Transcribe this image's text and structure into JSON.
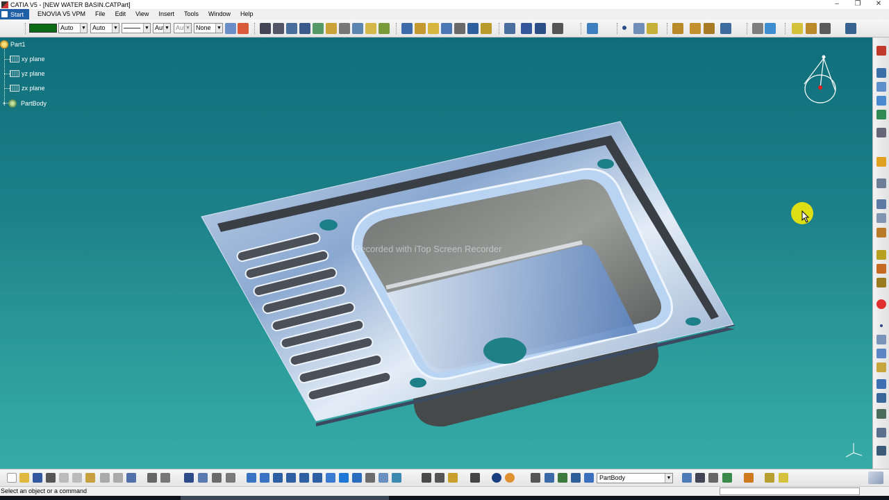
{
  "window": {
    "title": "CATIA V5 - [NEW WATER BASIN.CATPart]",
    "minimize_glyph": "–",
    "restore_glyph": "❐",
    "close_glyph": "✕"
  },
  "menubar": {
    "start": "Start",
    "items": [
      "ENOVIA V5 VPM",
      "File",
      "Edit",
      "View",
      "Insert",
      "Tools",
      "Window",
      "Help"
    ]
  },
  "graphic_properties": {
    "fill_color": "#0b6b15",
    "line_type": "Auto",
    "line_thickness": "Auto",
    "layer": "Aut",
    "layer2": "Aut",
    "filter": "None"
  },
  "spec_tree": {
    "root": "Part1",
    "items": [
      "xy plane",
      "yz plane",
      "zx plane",
      "PartBody"
    ]
  },
  "viewport": {
    "watermark": "Recorded with iTop Screen Recorder",
    "background_top": "#0f6e7a",
    "background_bottom": "#36aba6"
  },
  "bottom_toolbar": {
    "current_body": "PartBody"
  },
  "status": {
    "message": "Select an object or a command"
  },
  "accent_colors": {
    "menu_start": "#1e5fa8",
    "cursor_halo": "#fff000"
  }
}
